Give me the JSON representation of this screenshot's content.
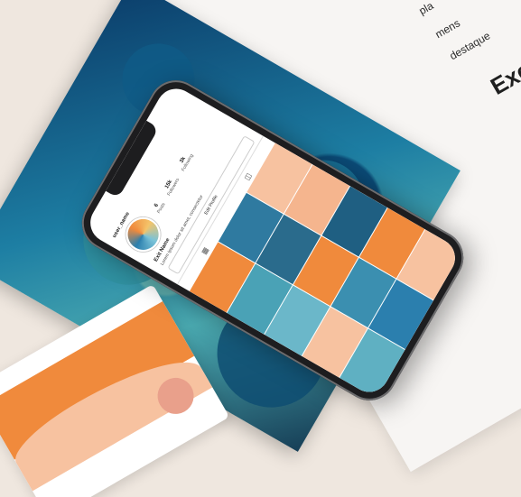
{
  "page": {
    "line1": "pla",
    "line2": "mens",
    "line3": "destaque",
    "heading": "Exe"
  },
  "phone": {
    "username": "user_name",
    "stats": [
      {
        "num": "6",
        "label": "Posts"
      },
      {
        "num": "15k",
        "label": "Followers"
      },
      {
        "num": "3k",
        "label": "Following"
      }
    ],
    "bio_name": "Exit Name",
    "bio_text": "Lorem ipsum dolor sit amet, consectetur",
    "edit_label": "Edit Profile",
    "tabs": [
      "grid-icon",
      "tag-icon"
    ],
    "tile_colors": [
      "#f08a3c",
      "#2f7aa0",
      "#f7c2a0",
      "#4aa2b6",
      "#2a6b8c",
      "#f5b58e",
      "#6bb7c9",
      "#f08a3c",
      "#1f5f82",
      "#f7c2a0",
      "#3b8fb0",
      "#f08a3c",
      "#5fb0c2",
      "#2b7fae",
      "#f7c2a0"
    ]
  },
  "app_card": {
    "menu": "•••"
  }
}
